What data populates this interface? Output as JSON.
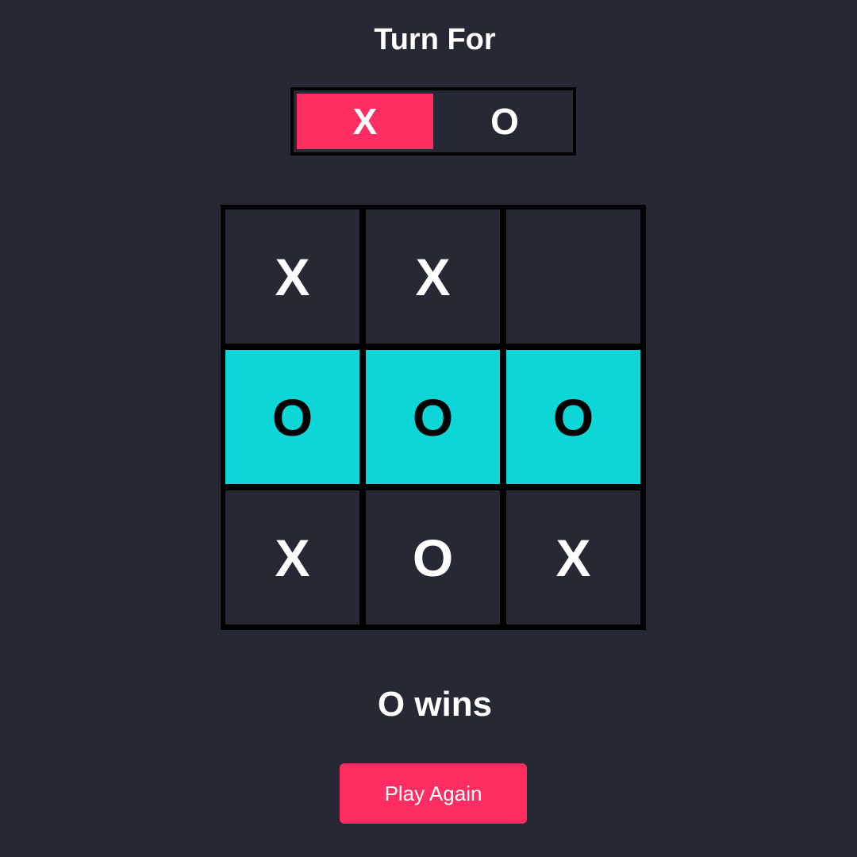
{
  "header": {
    "title": "Turn For"
  },
  "turn": {
    "options": [
      "X",
      "O"
    ],
    "active": "X"
  },
  "board": {
    "cells": [
      "X",
      "X",
      "",
      "O",
      "O",
      "O",
      "X",
      "O",
      "X"
    ],
    "winning_cells": [
      3,
      4,
      5
    ]
  },
  "result": {
    "text": "O wins"
  },
  "actions": {
    "play_again_label": "Play Again"
  },
  "colors": {
    "background": "#262833",
    "accent": "#ff2d62",
    "win_highlight": "#0dd6d7",
    "grid_line": "#000000"
  }
}
